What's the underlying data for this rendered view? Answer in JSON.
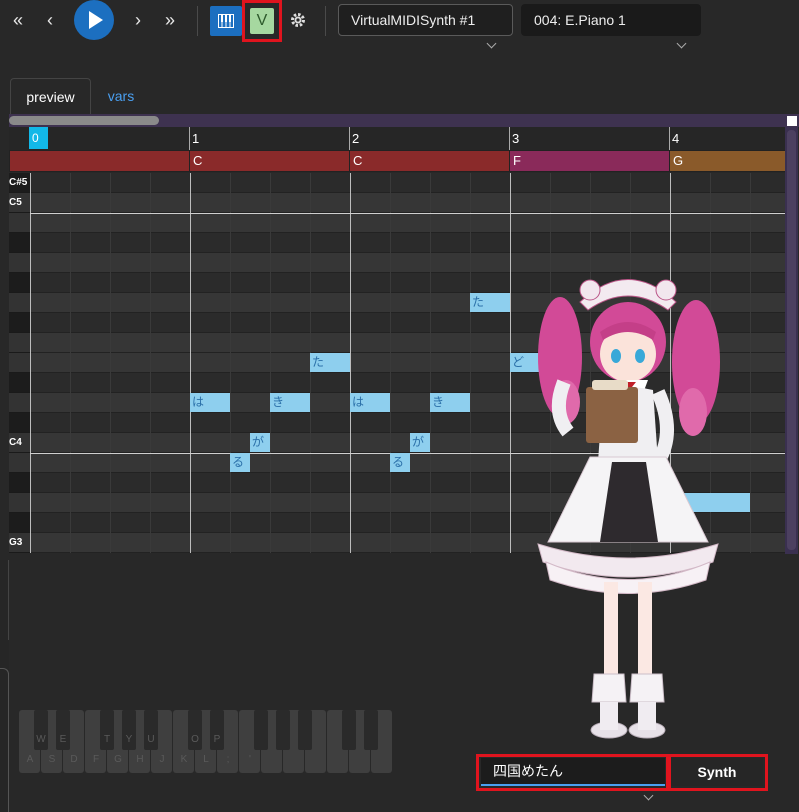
{
  "toolbar": {
    "rewind_icon": "rewind-to-start-icon",
    "prev_icon": "previous-icon",
    "play_icon": "play-icon",
    "next_icon": "next-icon",
    "forward_icon": "forward-to-end-icon",
    "pianoroll_icon": "piano-keyboard-icon",
    "vsynth_label": "V",
    "settings_icon": "gear-icon",
    "midi_output": "VirtualMIDISynth #1",
    "instrument": "004: E.Piano 1"
  },
  "tabs": [
    {
      "label": "preview",
      "active": true
    },
    {
      "label": "vars",
      "active": false
    }
  ],
  "roll": {
    "measures": [
      "0",
      "1",
      "2",
      "3",
      "4"
    ],
    "chords": [
      {
        "label": "",
        "color": "#8a2a2a"
      },
      {
        "label": "C",
        "color": "#8a2a2a"
      },
      {
        "label": "C",
        "color": "#8a2a2a"
      },
      {
        "label": "F",
        "color": "#8a2a5a"
      },
      {
        "label": "G",
        "color": "#8a5a2a"
      }
    ],
    "key_labels": {
      "cs5": "C#5",
      "c5": "C5",
      "c4": "C4",
      "g3": "G3"
    },
    "notes": [
      {
        "lyric": "は",
        "beat": 4,
        "row": 11,
        "len": 1
      },
      {
        "lyric": "る",
        "beat": 5,
        "row": 14,
        "len": 0.5
      },
      {
        "lyric": "が",
        "beat": 5.5,
        "row": 13,
        "len": 0.5
      },
      {
        "lyric": "き",
        "beat": 6,
        "row": 11,
        "len": 1
      },
      {
        "lyric": "た",
        "beat": 7,
        "row": 9,
        "len": 1
      },
      {
        "lyric": "は",
        "beat": 8,
        "row": 11,
        "len": 1
      },
      {
        "lyric": "る",
        "beat": 9,
        "row": 14,
        "len": 0.5
      },
      {
        "lyric": "が",
        "beat": 9.5,
        "row": 13,
        "len": 0.5
      },
      {
        "lyric": "き",
        "beat": 10,
        "row": 11,
        "len": 1
      },
      {
        "lyric": "た",
        "beat": 11,
        "row": 6,
        "len": 1
      },
      {
        "lyric": "ど",
        "beat": 12,
        "row": 9,
        "len": 1
      },
      {
        "lyric": "",
        "beat": 16,
        "row": 16,
        "len": 2
      }
    ]
  },
  "keyboard": {
    "upper": [
      "W",
      "E",
      "",
      "T",
      "Y",
      "U",
      "",
      "O",
      "P"
    ],
    "lower": [
      "A",
      "S",
      "D",
      "F",
      "G",
      "H",
      "J",
      "K",
      "L",
      ";",
      "'"
    ]
  },
  "character_image": "shikoku-metan-character",
  "bottom": {
    "singer": "四国めたん",
    "synth_label": "Synth"
  },
  "colors": {
    "accent": "#1c6fc0",
    "note": "#8ecfee",
    "highlight": "#e0141e",
    "playhead": "#12b8e8"
  }
}
